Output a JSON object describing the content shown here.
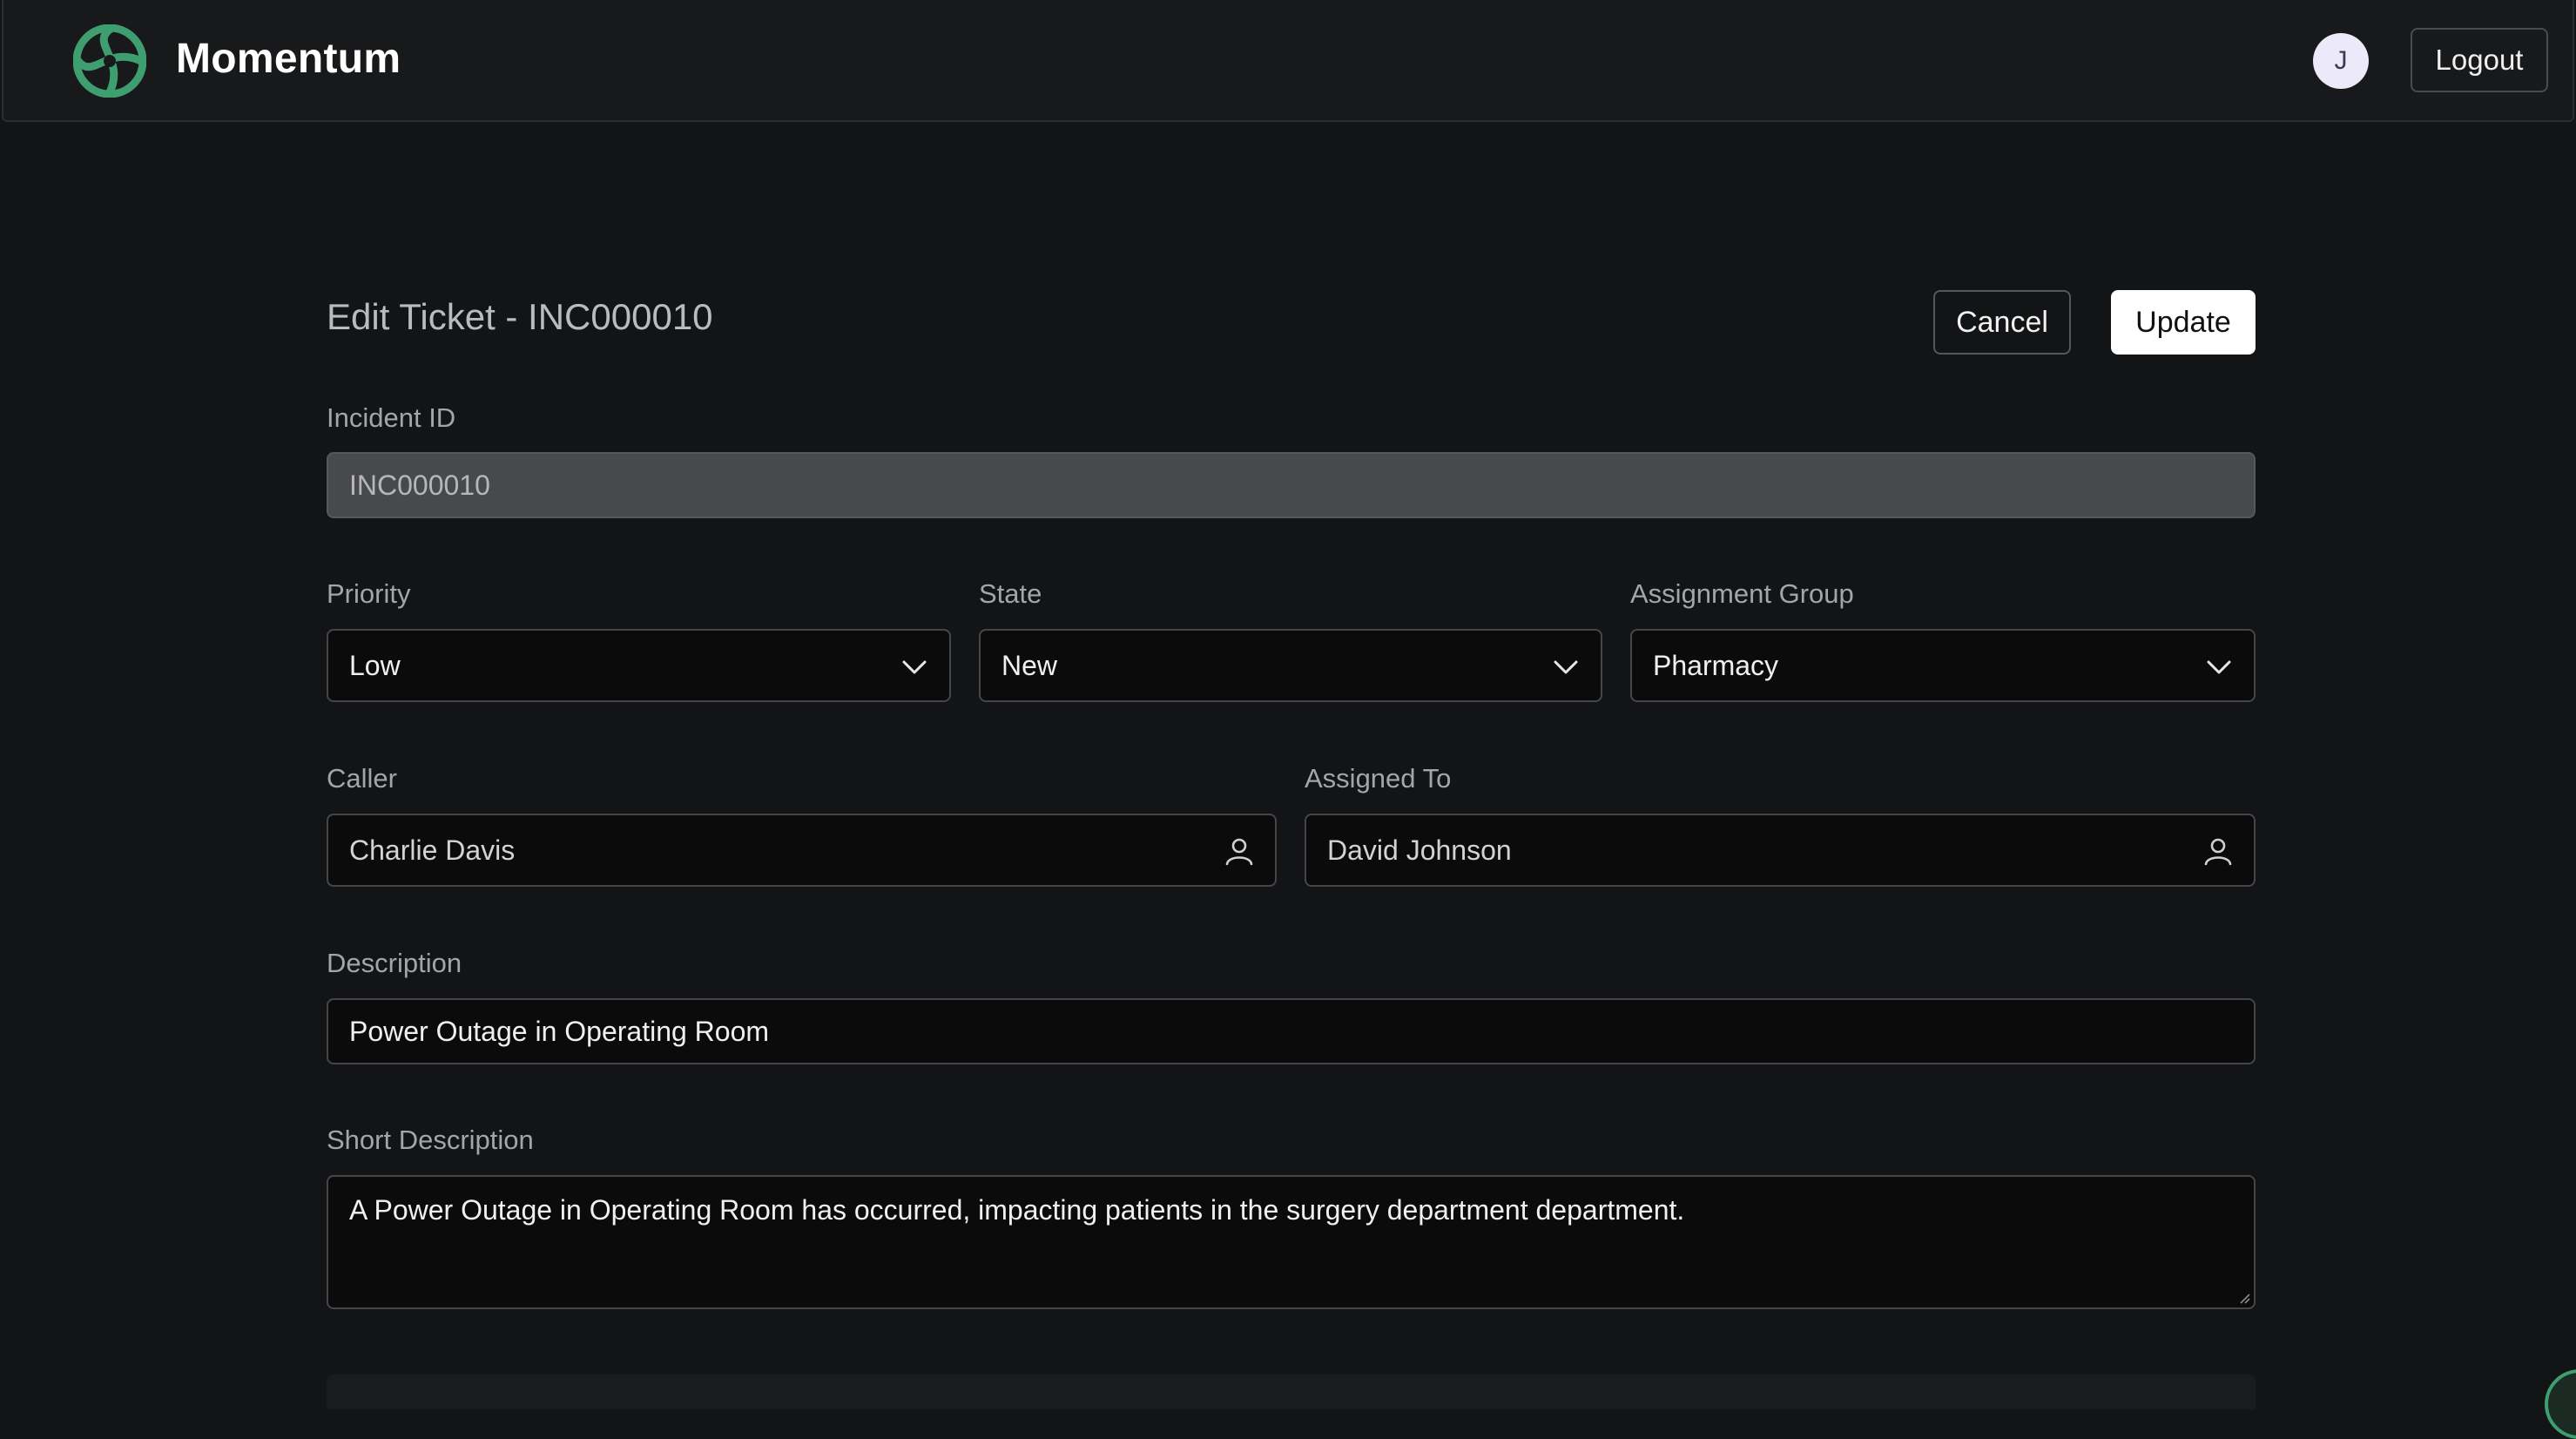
{
  "header": {
    "app_name": "Momentum",
    "logo_icon": "momentum-swirl-logo-icon",
    "avatar_initial": "J",
    "logout_label": "Logout",
    "brand_color": "#3f9e6f"
  },
  "form": {
    "title": "Edit Ticket - INC000010",
    "cancel_label": "Cancel",
    "update_label": "Update",
    "incident_id": {
      "label": "Incident ID",
      "value": "INC000010"
    },
    "priority": {
      "label": "Priority",
      "value": "Low",
      "icon": "chevron-down-icon"
    },
    "state": {
      "label": "State",
      "value": "New",
      "icon": "chevron-down-icon"
    },
    "assignment_group": {
      "label": "Assignment Group",
      "value": "Pharmacy",
      "icon": "chevron-down-icon"
    },
    "caller": {
      "label": "Caller",
      "value": "Charlie Davis",
      "icon": "person-icon"
    },
    "assigned_to": {
      "label": "Assigned To",
      "value": "David Johnson",
      "icon": "person-icon"
    },
    "description": {
      "label": "Description",
      "value": "Power Outage in Operating Room"
    },
    "short_description": {
      "label": "Short Description",
      "value": "A Power Outage in Operating Room has occurred, impacting patients in the surgery department department."
    }
  }
}
